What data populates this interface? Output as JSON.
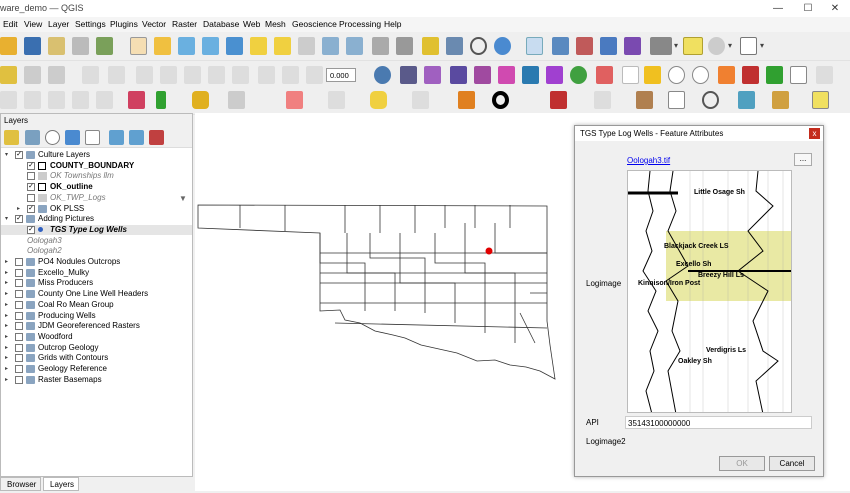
{
  "window": {
    "title": "ware_demo — QGIS",
    "min": "—",
    "max": "☐",
    "close": "✕"
  },
  "menu": [
    "Edit",
    "View",
    "Layer",
    "Settings",
    "Plugins",
    "Vector",
    "Raster",
    "Database",
    "Web",
    "Mesh",
    "Geoscience",
    "Processing",
    "Help"
  ],
  "toolbar": {
    "spin_value": "0.000"
  },
  "layers_panel": {
    "title": "Layers",
    "items": [
      {
        "label": "Culture Layers",
        "style": "normal"
      },
      {
        "label": "COUNTY_BOUNDARY",
        "style": "bold"
      },
      {
        "label": "OK Townships llm",
        "style": "italic"
      },
      {
        "label": "OK_outline",
        "style": "bold"
      },
      {
        "label": "OK_TWP_Logs",
        "style": "italic"
      },
      {
        "label": "OK PLSS",
        "style": "normal"
      },
      {
        "label": "Adding Pictures",
        "style": "normal"
      },
      {
        "label": "TGS Type Log Wells",
        "style": "bolditalic"
      },
      {
        "label": "Oologah3",
        "style": "italic"
      },
      {
        "label": "Oologah2",
        "style": "italic"
      },
      {
        "label": "PO4 Nodules Outcrops",
        "style": "normal"
      },
      {
        "label": "Excello_Mulky",
        "style": "normal"
      },
      {
        "label": "Miss Producers",
        "style": "normal"
      },
      {
        "label": "County One Line Well Headers",
        "style": "normal"
      },
      {
        "label": "Coal Ro Mean Group",
        "style": "normal"
      },
      {
        "label": "Producing Wells",
        "style": "normal"
      },
      {
        "label": "JDM Georeferenced Rasters",
        "style": "normal"
      },
      {
        "label": "Woodford",
        "style": "normal"
      },
      {
        "label": "Outcrop Geology",
        "style": "normal"
      },
      {
        "label": "Grids with Contours",
        "style": "normal"
      },
      {
        "label": "Geology Reference",
        "style": "normal"
      },
      {
        "label": "Raster Basemaps",
        "style": "normal"
      }
    ]
  },
  "bottom_tabs": [
    "Browser",
    "Layers"
  ],
  "dialog": {
    "title": "TGS Type Log Wells - Feature Attributes",
    "close": "x",
    "link": "Oologah3.tif",
    "ellipsis": "...",
    "logimage_label": "Logimage",
    "api_label": "API",
    "api_value": "35143100000000",
    "logimage2_label": "Logimage2",
    "ok": "OK",
    "cancel": "Cancel",
    "log_labels": [
      "Little Osage Sh",
      "Blackjack Creek LS",
      "Excello Sh",
      "Breezy Hill Ls",
      "Kinnison/Iron Post",
      "Verdigris Ls",
      "Oakley Sh"
    ]
  },
  "colors": {
    "accent": "#0078d7",
    "highlight": "#e7e79a",
    "well": "#e00000"
  }
}
